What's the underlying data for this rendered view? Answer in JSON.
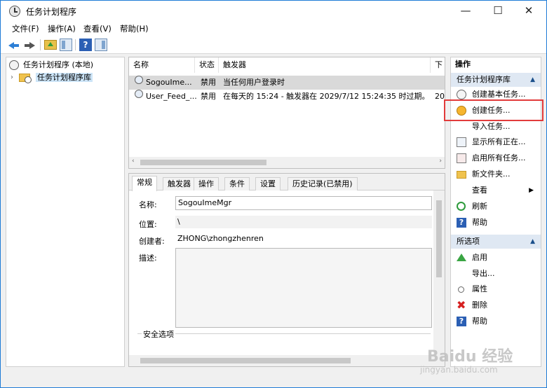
{
  "window": {
    "title": "任务计划程序",
    "minimize": "—",
    "maximize": "☐",
    "close": "✕"
  },
  "menu": [
    "文件(F)",
    "操作(A)",
    "查看(V)",
    "帮助(H)"
  ],
  "tree": {
    "root": "任务计划程序 (本地)",
    "child": "任务计划程序库"
  },
  "tasklist": {
    "headers": [
      "名称",
      "状态",
      "触发器",
      "下次"
    ],
    "rows": [
      {
        "name": "SogouIme...",
        "status": "禁用",
        "trigger": "当任何用户登录时",
        "next": ""
      },
      {
        "name": "User_Feed_...",
        "status": "禁用",
        "trigger": "在每天的 15:24 - 触发器在 2029/7/12 15:24:35 时过期。",
        "next": "20"
      }
    ]
  },
  "details": {
    "tabs": [
      "常规",
      "触发器",
      "操作",
      "条件",
      "设置",
      "历史记录(已禁用)"
    ],
    "name_label": "名称:",
    "name_value": "SogouImeMgr",
    "location_label": "位置:",
    "location_value": "\\",
    "author_label": "创建者:",
    "author_value": "ZHONG\\zhongzhenren",
    "desc_label": "描述:",
    "security_label": "安全选项"
  },
  "actions": {
    "header": "操作",
    "group1": "任务计划程序库",
    "items1": [
      "创建基本任务...",
      "创建任务...",
      "导入任务...",
      "显示所有正在...",
      "启用所有任务...",
      "新文件夹...",
      "查看",
      "刷新",
      "帮助"
    ],
    "group2": "所选项",
    "items2": [
      "启用",
      "导出...",
      "属性",
      "删除",
      "帮助"
    ]
  },
  "watermark": {
    "brand": "Baidu 经验",
    "url": "jingyan.baidu.com"
  }
}
